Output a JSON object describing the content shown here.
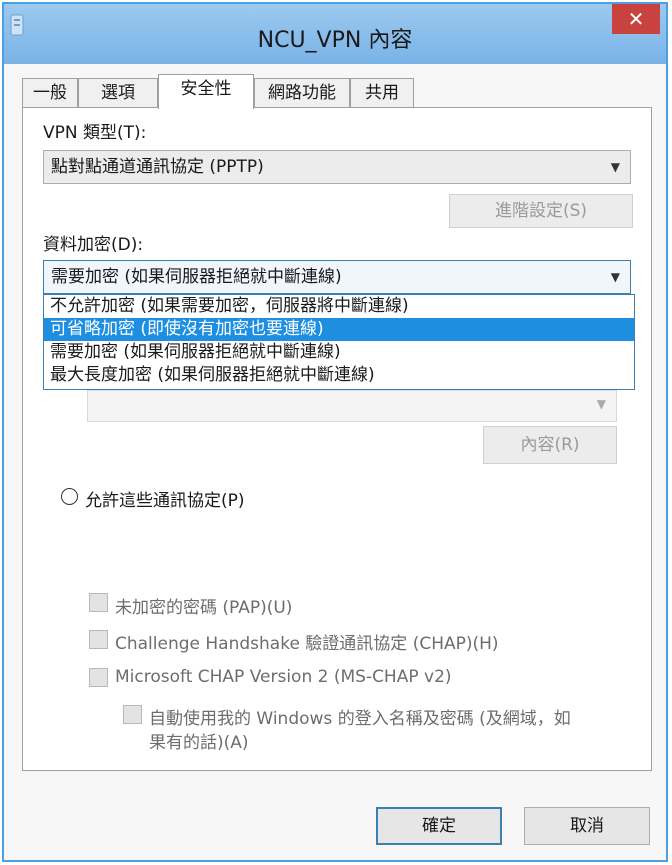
{
  "window": {
    "title": "NCU_VPN 內容",
    "close_symbol": "✕"
  },
  "tabs": [
    {
      "label": "一般",
      "active": false
    },
    {
      "label": "選項",
      "active": false
    },
    {
      "label": "安全性",
      "active": true
    },
    {
      "label": "網路功能",
      "active": false
    },
    {
      "label": "共用",
      "active": false
    }
  ],
  "security": {
    "vpn_type_label": "VPN 類型(T):",
    "vpn_type_value": "點對點通道通訊協定 (PPTP)",
    "advanced_button": "進階設定(S)",
    "encryption_label": "資料加密(D):",
    "encryption_value": "需要加密 (如果伺服器拒絕就中斷連線)",
    "encryption_options": [
      {
        "label": "不允許加密 (如果需要加密，伺服器將中斷連線)",
        "selected": false
      },
      {
        "label": "可省略加密 (即使沒有加密也要連線)",
        "selected": true
      },
      {
        "label": "需要加密 (如果伺服器拒絕就中斷連線)",
        "selected": false
      },
      {
        "label": "最大長度加密 (如果伺服器拒絕就中斷連線)",
        "selected": false
      }
    ],
    "properties_button": "內容(R)",
    "allow_protocols_label": "允許這些通訊協定(P)",
    "checkboxes": [
      {
        "label": "未加密的密碼 (PAP)(U)",
        "checked": false
      },
      {
        "label": "Challenge Handshake 驗證通訊協定 (CHAP)(H)",
        "checked": false
      },
      {
        "label": "Microsoft CHAP Version 2 (MS-CHAP v2)",
        "checked": false
      }
    ],
    "auto_windows_logon_line1": "自動使用我的 Windows 的登入名稱及密碼 (及網域，如",
    "auto_windows_logon_line2": "果有的話)(A)"
  },
  "footer": {
    "ok_button": "確定",
    "cancel_button": "取消"
  },
  "colors": {
    "titlebar": "#8ec0ec",
    "close_button": "#c8433f",
    "selection": "#1e8fe0",
    "focus_border": "#3c7fb1"
  }
}
